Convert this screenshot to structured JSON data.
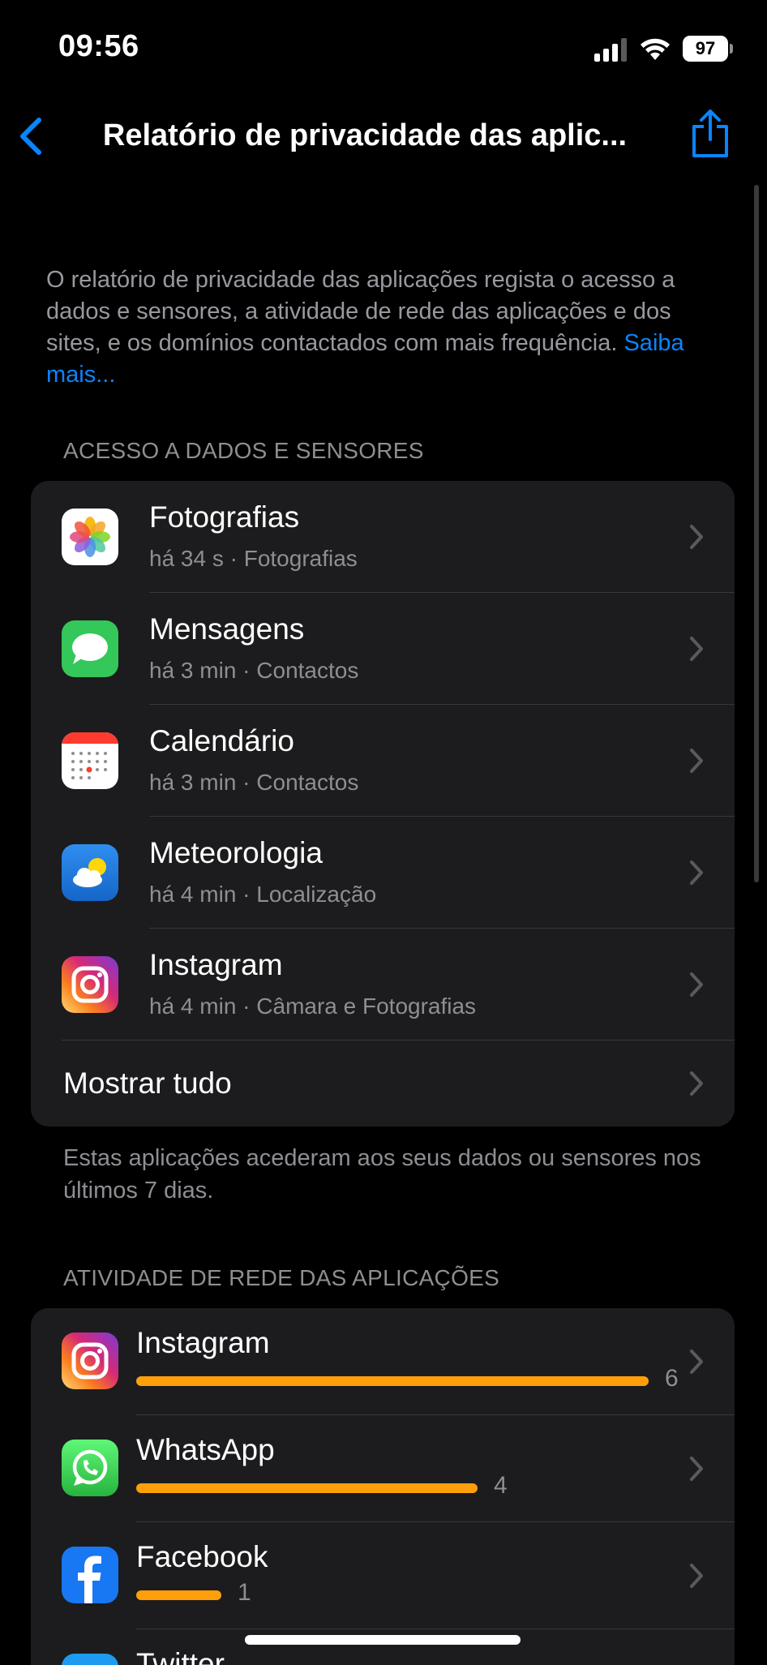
{
  "status_bar": {
    "time": "09:56",
    "battery": "97"
  },
  "nav": {
    "title": "Relatório de privacidade das aplic...",
    "back_icon": "chevron-left-icon",
    "share_icon": "share-icon"
  },
  "intro": {
    "text": "O relatório de privacidade das aplicações regista o acesso a dados e sensores, a atividade de rede das aplicações e dos sites, e os domínios contactados com mais frequência. ",
    "link": "Saiba mais..."
  },
  "data_access": {
    "header": "ACESSO A DADOS E SENSORES",
    "items": [
      {
        "title": "Fotografias",
        "subtitle": "há 34 s · Fotografias",
        "icon": "photos-app-icon"
      },
      {
        "title": "Mensagens",
        "subtitle": "há 3 min · Contactos",
        "icon": "messages-app-icon"
      },
      {
        "title": "Calendário",
        "subtitle": "há 3 min · Contactos",
        "icon": "calendar-app-icon"
      },
      {
        "title": "Meteorologia",
        "subtitle": "há 4 min · Localização",
        "icon": "weather-app-icon"
      },
      {
        "title": "Instagram",
        "subtitle": "há 4 min · Câmara e Fotografias",
        "icon": "instagram-app-icon"
      }
    ],
    "show_all": "Mostrar tudo",
    "footnote": "Estas aplicações acederam aos seus dados ou sensores nos últimos 7 dias."
  },
  "network_activity": {
    "header": "ATIVIDADE DE REDE DAS APLICAÇÕES",
    "accent_color": "#ff9f0a",
    "max_count": 6,
    "items": [
      {
        "title": "Instagram",
        "count": "6",
        "value": 6,
        "icon": "instagram-app-icon"
      },
      {
        "title": "WhatsApp",
        "count": "4",
        "value": 4,
        "icon": "whatsapp-app-icon"
      },
      {
        "title": "Facebook",
        "count": "1",
        "value": 1,
        "icon": "facebook-app-icon"
      },
      {
        "title": "Twitter",
        "icon": "twitter-app-icon"
      }
    ]
  }
}
